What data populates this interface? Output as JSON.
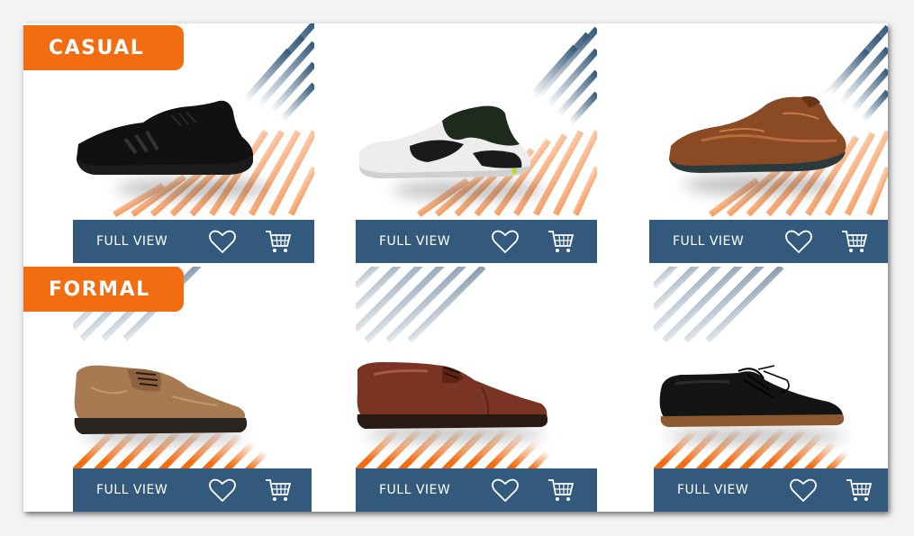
{
  "categories": {
    "casual": "CASUAL",
    "formal": "FORMAL"
  },
  "colors": {
    "accent_orange": "#f26c12",
    "bar_blue": "#335a7c",
    "stripe_blue": "#365a7a"
  },
  "products": [
    {
      "name": "black-running-shoe",
      "full_view_label": "FULL VIEW",
      "heart_icon": "heart-icon",
      "cart_icon": "cart-icon"
    },
    {
      "name": "white-black-sneaker",
      "full_view_label": "FULL VIEW",
      "heart_icon": "heart-icon",
      "cart_icon": "cart-icon"
    },
    {
      "name": "copper-chunky-sneaker",
      "full_view_label": "FULL VIEW",
      "heart_icon": "heart-icon",
      "cart_icon": "cart-icon"
    },
    {
      "name": "tan-suede-derby",
      "full_view_label": "FULL VIEW",
      "heart_icon": "heart-icon",
      "cart_icon": "cart-icon"
    },
    {
      "name": "brown-leather-oxford",
      "full_view_label": "FULL VIEW",
      "heart_icon": "heart-icon",
      "cart_icon": "cart-icon"
    },
    {
      "name": "black-leather-derby",
      "full_view_label": "FULL VIEW",
      "heart_icon": "heart-icon",
      "cart_icon": "cart-icon"
    }
  ]
}
